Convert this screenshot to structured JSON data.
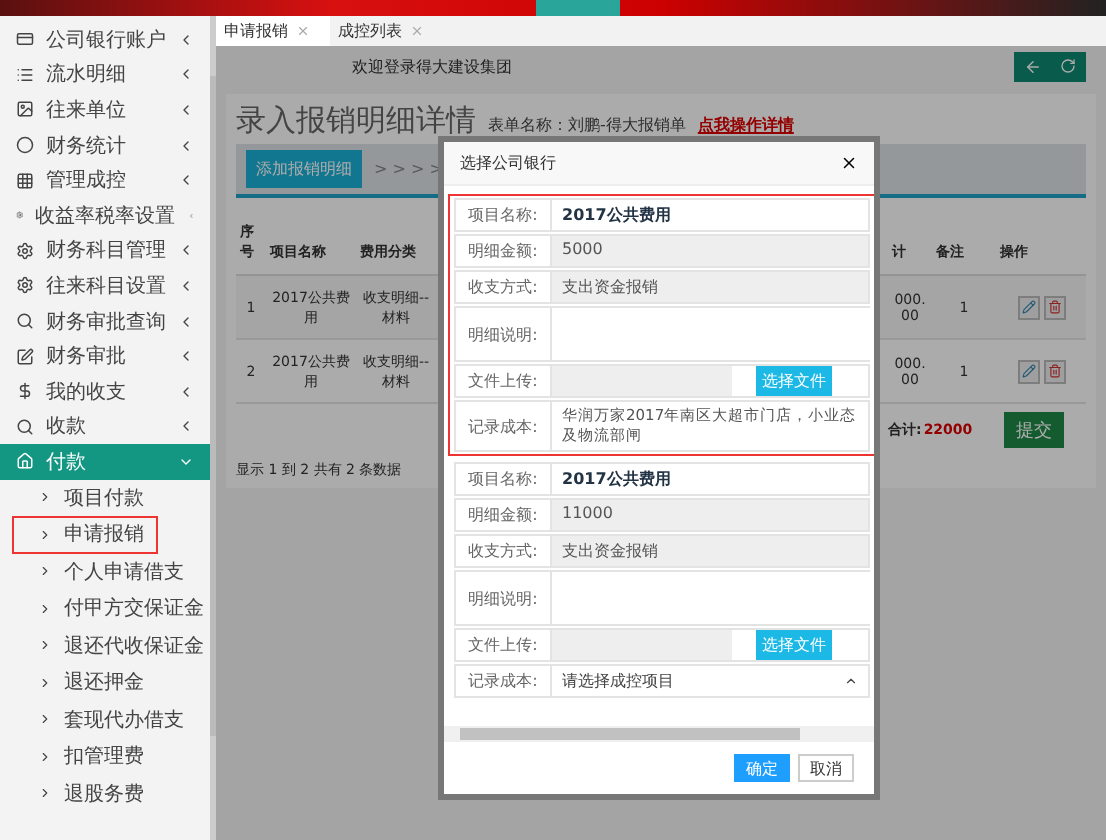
{
  "sidebar": {
    "items": [
      {
        "label": "公司银行账户",
        "expanded": false
      },
      {
        "label": "流水明细",
        "expanded": false
      },
      {
        "label": "往来单位",
        "expanded": false
      },
      {
        "label": "财务统计",
        "expanded": false
      },
      {
        "label": "管理成控",
        "expanded": false
      },
      {
        "label": "收益率税率设置",
        "expanded": false
      },
      {
        "label": "财务科目管理",
        "expanded": false
      },
      {
        "label": "往来科目设置",
        "expanded": false
      },
      {
        "label": "财务审批查询",
        "expanded": false
      },
      {
        "label": "财务审批",
        "expanded": false
      },
      {
        "label": "我的收支",
        "expanded": false
      },
      {
        "label": "收款",
        "expanded": false
      },
      {
        "label": "付款",
        "expanded": true,
        "children": [
          {
            "label": "项目付款",
            "highlighted": false
          },
          {
            "label": "申请报销",
            "highlighted": true
          },
          {
            "label": "个人申请借支",
            "highlighted": false
          },
          {
            "label": "付甲方交保证金",
            "highlighted": false
          },
          {
            "label": "退还代收保证金",
            "highlighted": false
          },
          {
            "label": "退还押金",
            "highlighted": false
          },
          {
            "label": "套现代办借支",
            "highlighted": false
          },
          {
            "label": "扣管理费",
            "highlighted": false
          },
          {
            "label": "退股务费",
            "highlighted": false
          }
        ]
      }
    ]
  },
  "tabs": [
    {
      "label": "申请报销",
      "selected": true
    },
    {
      "label": "成控列表",
      "selected": false
    }
  ],
  "header": {
    "welcome": "欢迎登录得大建设集团"
  },
  "panel": {
    "title": "录入报销明细详情",
    "form_name": "表单名称：刘鹏-得大报销单",
    "detail_link": "点我操作详情",
    "add_button": "添加报销明细",
    "steps": "> > > >"
  },
  "table": {
    "columns": [
      "序号",
      "项目名称",
      "费用分类",
      "计",
      "备注",
      "操作"
    ],
    "rows": [
      {
        "cells": [
          "1",
          "2017公共费用",
          "收支明细--材料",
          "000.00",
          "1"
        ]
      },
      {
        "cells": [
          "2",
          "2017公共费用",
          "收支明细--材料",
          "000.00",
          "1"
        ]
      }
    ],
    "total_label": "合计:",
    "total_value": "22000",
    "submit": "提交",
    "footer": "显示 1 到 2 共有 2 条数据"
  },
  "dialog": {
    "title": "选择公司银行",
    "forms": [
      {
        "highlighted": true,
        "fields": [
          {
            "kind": "name",
            "label": "项目名称:",
            "value": "2017公共费用"
          },
          {
            "kind": "readonly",
            "label": "明细金额:",
            "value": "5000"
          },
          {
            "kind": "readonly",
            "label": "收支方式:",
            "value": "支出资金报销"
          },
          {
            "kind": "textarea",
            "label": "明细说明:"
          },
          {
            "kind": "file",
            "label": "文件上传:",
            "button": "选择文件"
          },
          {
            "kind": "text",
            "label": "记录成本:",
            "value": "华润万家2017年南区大超市门店，小业态及物流部闸"
          }
        ]
      },
      {
        "highlighted": false,
        "fields": [
          {
            "kind": "name",
            "label": "项目名称:",
            "value": "2017公共费用"
          },
          {
            "kind": "readonly",
            "label": "明细金额:",
            "value": "11000"
          },
          {
            "kind": "readonly",
            "label": "收支方式:",
            "value": "支出资金报销"
          },
          {
            "kind": "textarea",
            "label": "明细说明:"
          },
          {
            "kind": "file",
            "label": "文件上传:",
            "button": "选择文件"
          },
          {
            "kind": "select",
            "label": "记录成本:",
            "value": "请选择成控项目"
          }
        ]
      }
    ],
    "buttons": [
      {
        "label": "确定",
        "primary": true
      },
      {
        "label": "取消",
        "primary": false
      }
    ]
  }
}
